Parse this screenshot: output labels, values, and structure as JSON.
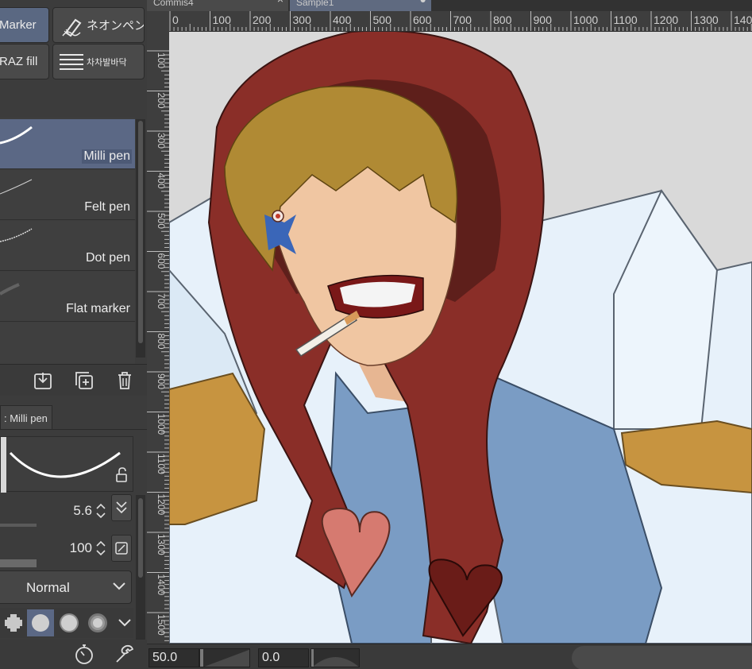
{
  "subtools": {
    "marker": "Marker",
    "neon": "ネオンペン",
    "raz_fill": "RAZ fill",
    "chacha": "차차발바닥"
  },
  "brushes": [
    {
      "name": "Milli pen",
      "selected": true
    },
    {
      "name": "Felt pen",
      "selected": false
    },
    {
      "name": "Dot pen",
      "selected": false
    },
    {
      "name": "Flat marker",
      "selected": false
    }
  ],
  "list_tools": {
    "import_icon": "import-icon",
    "duplicate_icon": "duplicate-icon",
    "delete_icon": "trash-icon"
  },
  "properties": {
    "tab_label": ": Milli pen",
    "brush_size": "5.6",
    "opacity": "100",
    "blend_mode": "Normal"
  },
  "tabs": [
    {
      "label": "Commis4",
      "active": false
    },
    {
      "label": "Sample1",
      "active": true
    }
  ],
  "ruler": {
    "top": [
      "0",
      "100",
      "200",
      "300",
      "400",
      "500",
      "600",
      "700",
      "800",
      "900",
      "1000",
      "1100",
      "1200",
      "1300",
      "1400"
    ],
    "left": [
      "100",
      "200",
      "300",
      "400",
      "500",
      "600",
      "700",
      "800",
      "900",
      "1000",
      "1100",
      "1200",
      "1300",
      "1400",
      "1500"
    ]
  },
  "status": {
    "zoom": "50.0",
    "rotation": "0.0"
  },
  "colors": {
    "selected_bg": "#5b6885",
    "panel_bg": "#3c3c3c"
  }
}
